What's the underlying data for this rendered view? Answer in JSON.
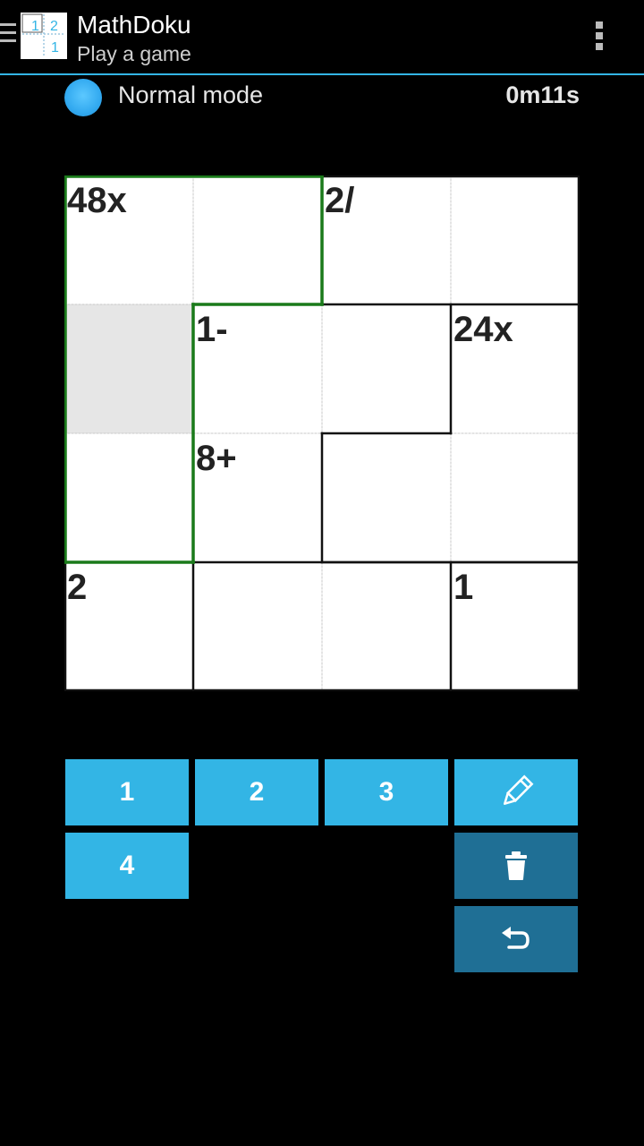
{
  "app": {
    "title": "MathDoku",
    "subtitle": "Play a game"
  },
  "app_icon": {
    "digits": [
      "1",
      "2",
      "1"
    ]
  },
  "status": {
    "mode": "Normal mode",
    "timer": "0m11s"
  },
  "grid": {
    "size": 4,
    "cells": [
      {
        "row": 0,
        "col": 0,
        "cage": "48x"
      },
      {
        "row": 0,
        "col": 1,
        "cage": ""
      },
      {
        "row": 0,
        "col": 2,
        "cage": "2/"
      },
      {
        "row": 0,
        "col": 3,
        "cage": ""
      },
      {
        "row": 1,
        "col": 0,
        "cage": "",
        "selected": true
      },
      {
        "row": 1,
        "col": 1,
        "cage": "1-"
      },
      {
        "row": 1,
        "col": 2,
        "cage": ""
      },
      {
        "row": 1,
        "col": 3,
        "cage": "24x"
      },
      {
        "row": 2,
        "col": 0,
        "cage": ""
      },
      {
        "row": 2,
        "col": 1,
        "cage": "8+"
      },
      {
        "row": 2,
        "col": 2,
        "cage": ""
      },
      {
        "row": 2,
        "col": 3,
        "cage": ""
      },
      {
        "row": 3,
        "col": 0,
        "cage": "2"
      },
      {
        "row": 3,
        "col": 1,
        "cage": ""
      },
      {
        "row": 3,
        "col": 2,
        "cage": ""
      },
      {
        "row": 3,
        "col": 3,
        "cage": "1"
      }
    ],
    "highlight_color": "#1a7a1a",
    "selected_cell_color": "#e6e6e6"
  },
  "keypad": {
    "digits": [
      "1",
      "2",
      "3",
      "4"
    ],
    "pencil_icon": "pencil-icon",
    "delete_icon": "trash-icon",
    "undo_icon": "undo-icon",
    "accent": "#33b5e5",
    "dark_accent": "#1f6f95"
  }
}
